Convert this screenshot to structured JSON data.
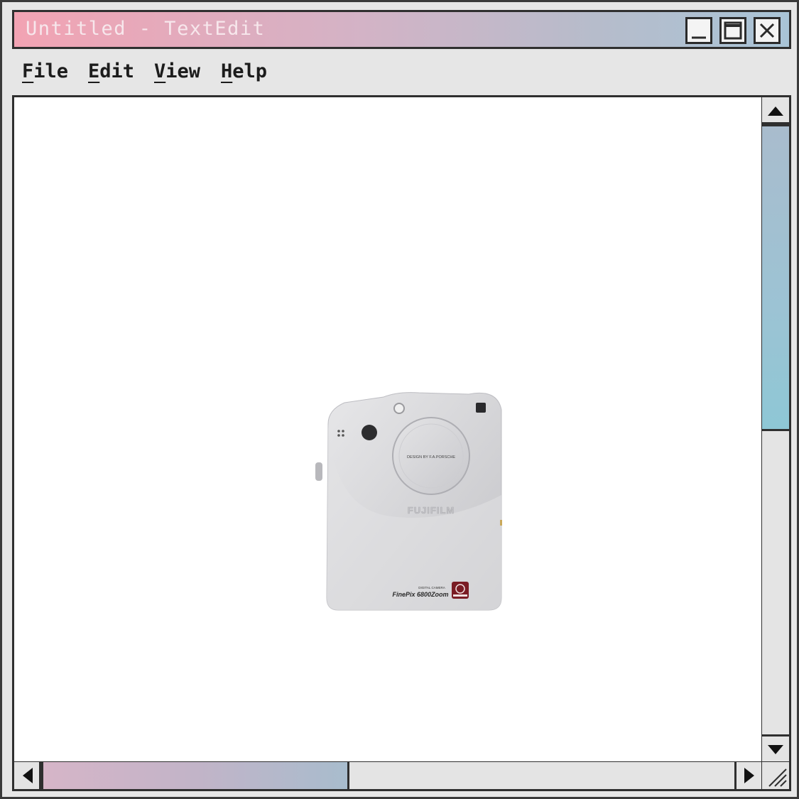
{
  "window": {
    "title": "Untitled - TextEdit",
    "accent_gradient": [
      "#f2a3b3",
      "#a9c4d6"
    ],
    "buttons": {
      "minimize": "minimize-icon",
      "maximize": "maximize-icon",
      "close": "close-icon"
    }
  },
  "menu": {
    "items": [
      {
        "first": "F",
        "rest": "ile"
      },
      {
        "first": "E",
        "rest": "dit"
      },
      {
        "first": "V",
        "rest": "iew"
      },
      {
        "first": "H",
        "rest": "elp"
      }
    ]
  },
  "photo": {
    "caption_lens": "DESIGN BY F.A.PORSCHE",
    "brand": "FUJIFILM",
    "label_small": "DIGITAL CAMERA",
    "model": "FinePix 6800Zoom",
    "body_color": "#d9d9db"
  }
}
